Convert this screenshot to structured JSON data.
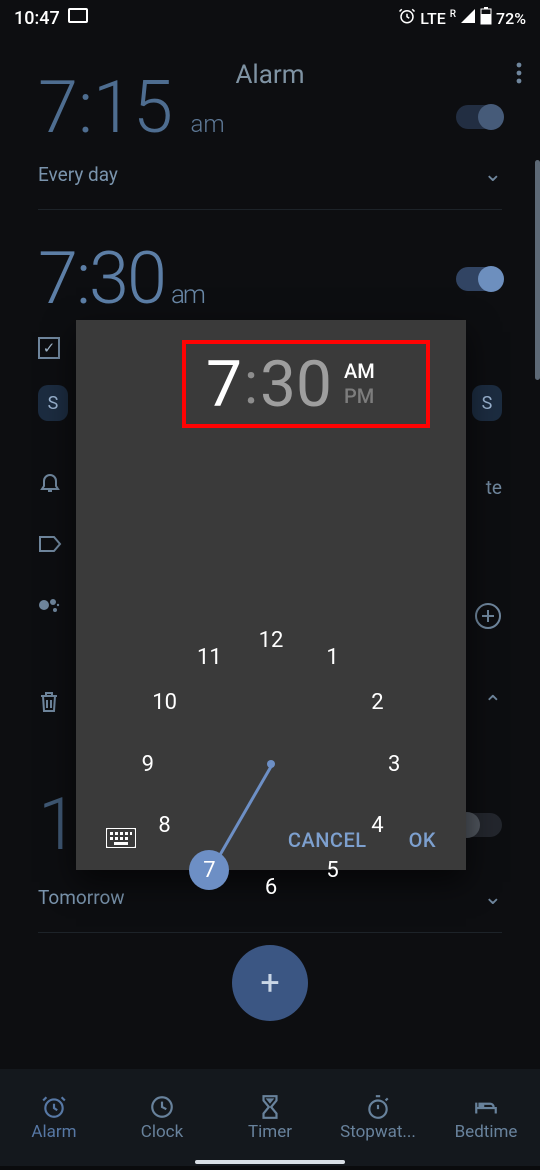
{
  "status": {
    "time": "10:47",
    "network": "LTE",
    "battery": "72%"
  },
  "header": {
    "title": "Alarm"
  },
  "alarms": {
    "top_partial": "7:15",
    "top_ampm": "am",
    "every_day": "Every day",
    "second_time": "7:30",
    "second_ampm": "am",
    "last_time": "1",
    "tomorrow": "Tomorrow",
    "chip_s1": "S",
    "chip_s2": "S"
  },
  "dialog": {
    "hour": "7",
    "minute": "30",
    "am": "AM",
    "pm": "PM",
    "cancel": "CANCEL",
    "ok": "OK",
    "numbers": [
      "12",
      "1",
      "2",
      "3",
      "4",
      "5",
      "6",
      "7",
      "8",
      "9",
      "10",
      "11"
    ],
    "selected_hour": 7
  },
  "nav": {
    "alarm": "Alarm",
    "clock": "Clock",
    "timer": "Timer",
    "stopwatch": "Stopwat...",
    "bedtime": "Bedtime"
  },
  "icons": {
    "cast": "cast-icon",
    "alarm": "alarm-icon",
    "signal": "signal-icon",
    "battery": "battery-icon",
    "menu": "menu-icon",
    "chevron": "chevron-down-icon",
    "check": "check-icon",
    "bell": "bell-icon",
    "tag": "tag-icon",
    "assistant": "assistant-icon",
    "trash": "trash-icon",
    "caret": "caret-up-icon",
    "plus": "plus-icon",
    "add": "add-circle-icon",
    "keyboard": "keyboard-icon",
    "clock": "clock-icon",
    "timer": "hourglass-icon",
    "stopwatch": "stopwatch-icon",
    "bed": "bed-icon"
  }
}
